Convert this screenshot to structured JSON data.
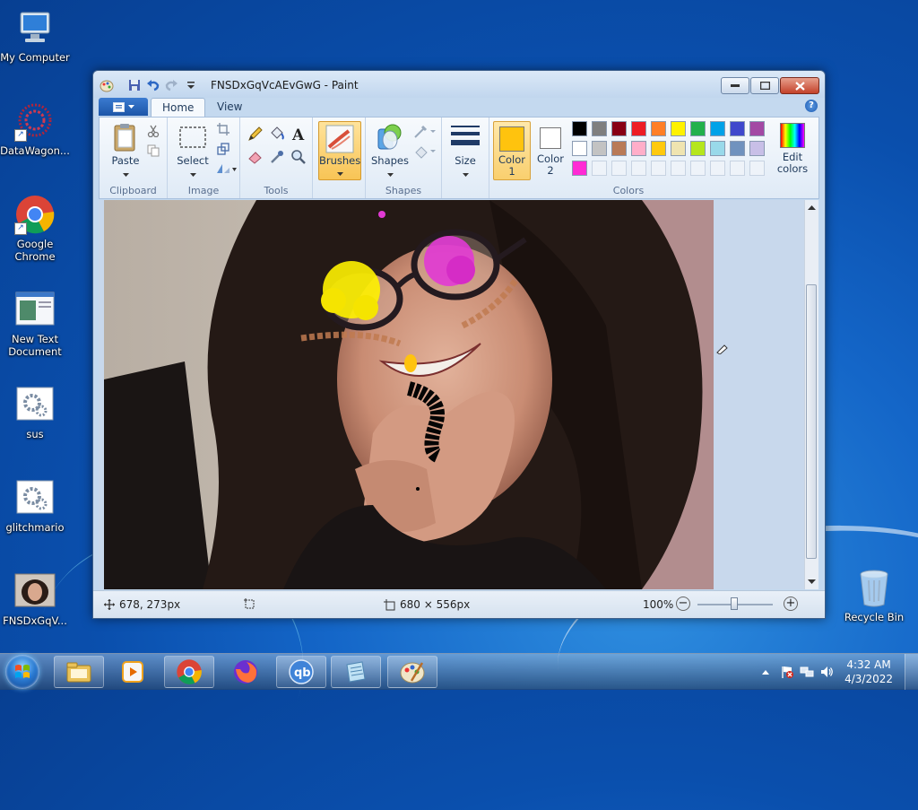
{
  "desktop": {
    "icons": [
      {
        "label": "My Computer",
        "icon": "computer-icon"
      },
      {
        "label": "DataWagon...",
        "icon": "datawagon-icon"
      },
      {
        "label": "Google Chrome",
        "icon": "chrome-icon"
      },
      {
        "label": "New Text Document",
        "icon": "text-document-icon"
      },
      {
        "label": "sus",
        "icon": "settings-file-icon"
      },
      {
        "label": "glitchmario",
        "icon": "settings-file-icon"
      },
      {
        "label": "FNSDxGqV...",
        "icon": "image-file-icon"
      },
      {
        "label": "Recycle Bin",
        "icon": "recycle-bin-icon"
      }
    ]
  },
  "paint": {
    "title": "FNSDxGqVcAEvGwG - Paint",
    "tabs": [
      {
        "label": "Home",
        "active": true
      },
      {
        "label": "View",
        "active": false
      }
    ],
    "ribbon": {
      "clipboard": {
        "label": "Clipboard",
        "paste": "Paste"
      },
      "image": {
        "label": "Image",
        "select": "Select"
      },
      "tools": {
        "label": "Tools"
      },
      "brushes": {
        "label": "Brushes"
      },
      "shapes": {
        "label": "Shapes",
        "button": "Shapes"
      },
      "size": {
        "label": "Size"
      },
      "colors": {
        "label": "Colors",
        "color1": "Color 1",
        "color2": "Color 2",
        "edit": "Edit colors",
        "color1_value": "#ffc30e",
        "color2_value": "#ffffff",
        "palette_row1": [
          "#000000",
          "#7f7f7f",
          "#880015",
          "#ed1c24",
          "#ff7f27",
          "#fff200",
          "#22b14c",
          "#00a2e8",
          "#3f48cc",
          "#a349a4"
        ],
        "palette_row2": [
          "#ffffff",
          "#c3c3c3",
          "#b97a57",
          "#ffaec9",
          "#ffc90e",
          "#efe4b0",
          "#b5e61d",
          "#99d9ea",
          "#7092be",
          "#c8bfe7"
        ],
        "palette_row3": [
          "#ff2ad4"
        ]
      }
    },
    "status": {
      "cursor_pos": "678, 273px",
      "selection_size": "",
      "image_size": "680 × 556px",
      "zoom": "100%"
    }
  },
  "taskbar": {
    "buttons": [
      "explorer-icon",
      "media-player-icon",
      "chrome-icon",
      "firefox-icon",
      "qbittorrent-icon",
      "notepad-icon",
      "paint-icon"
    ],
    "time": "4:32 AM",
    "date": "4/3/2022"
  }
}
